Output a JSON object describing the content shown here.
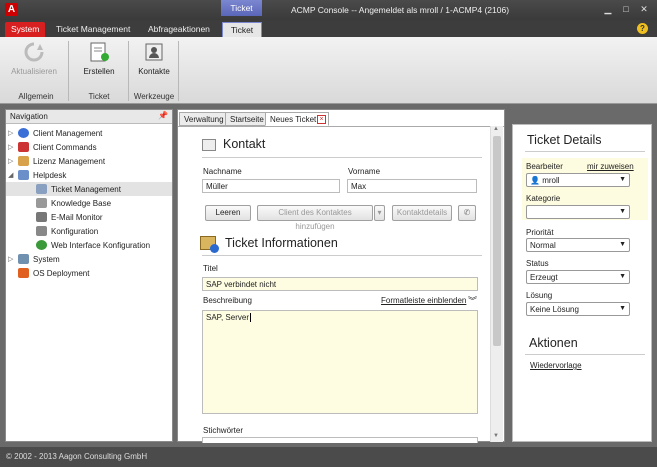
{
  "window": {
    "title": "ACMP Console -- Angemeldet als mroll / 1-ACMP4 (2106)",
    "contextual_tab": "Ticket"
  },
  "ribbon": {
    "tabs": [
      "System",
      "Ticket Management",
      "Abfrageaktionen",
      "Ticket"
    ],
    "buttons": {
      "refresh": "Aktualisieren",
      "create": "Erstellen",
      "contacts": "Kontakte"
    },
    "groups": {
      "general": "Allgemein",
      "ticket": "Ticket",
      "tools": "Werkzeuge"
    }
  },
  "navigation": {
    "title": "Navigation",
    "items": [
      "Client Management",
      "Client Commands",
      "Lizenz Management",
      "Helpdesk",
      "Ticket Management",
      "Knowledge Base",
      "E-Mail Monitor",
      "Konfiguration",
      "Web Interface Konfiguration",
      "System",
      "OS Deployment"
    ]
  },
  "doc_tabs": [
    "Verwaltung",
    "Startseite",
    "Neues Ticket"
  ],
  "contact": {
    "heading": "Kontakt",
    "lastname_label": "Nachname",
    "lastname": "Müller",
    "firstname_label": "Vorname",
    "firstname": "Max",
    "clear": "Leeren",
    "add_contact": "Client des Kontaktes hinzufügen",
    "details": "Kontaktdetails"
  },
  "ticket_info": {
    "heading": "Ticket Informationen",
    "title_label": "Titel",
    "title": "SAP verbindet nicht",
    "desc_label": "Beschreibung",
    "formatbar": "Formatleiste einblenden",
    "desc": "SAP, Server",
    "keywords_label": "Stichwörter"
  },
  "details": {
    "heading": "Ticket Details",
    "editor_label": "Bearbeiter",
    "assign_self": "mir zuweisen",
    "editor": "mroll",
    "category_label": "Kategorie",
    "category": "",
    "priority_label": "Priorität",
    "priority": "Normal",
    "status_label": "Status",
    "status": "Erzeugt",
    "solution_label": "Lösung",
    "solution": "Keine Lösung",
    "actions_heading": "Aktionen",
    "resubmission": "Wiedervorlage"
  },
  "statusbar": {
    "copyright": "© 2002 - 2013 Aagon Consulting GmbH"
  }
}
